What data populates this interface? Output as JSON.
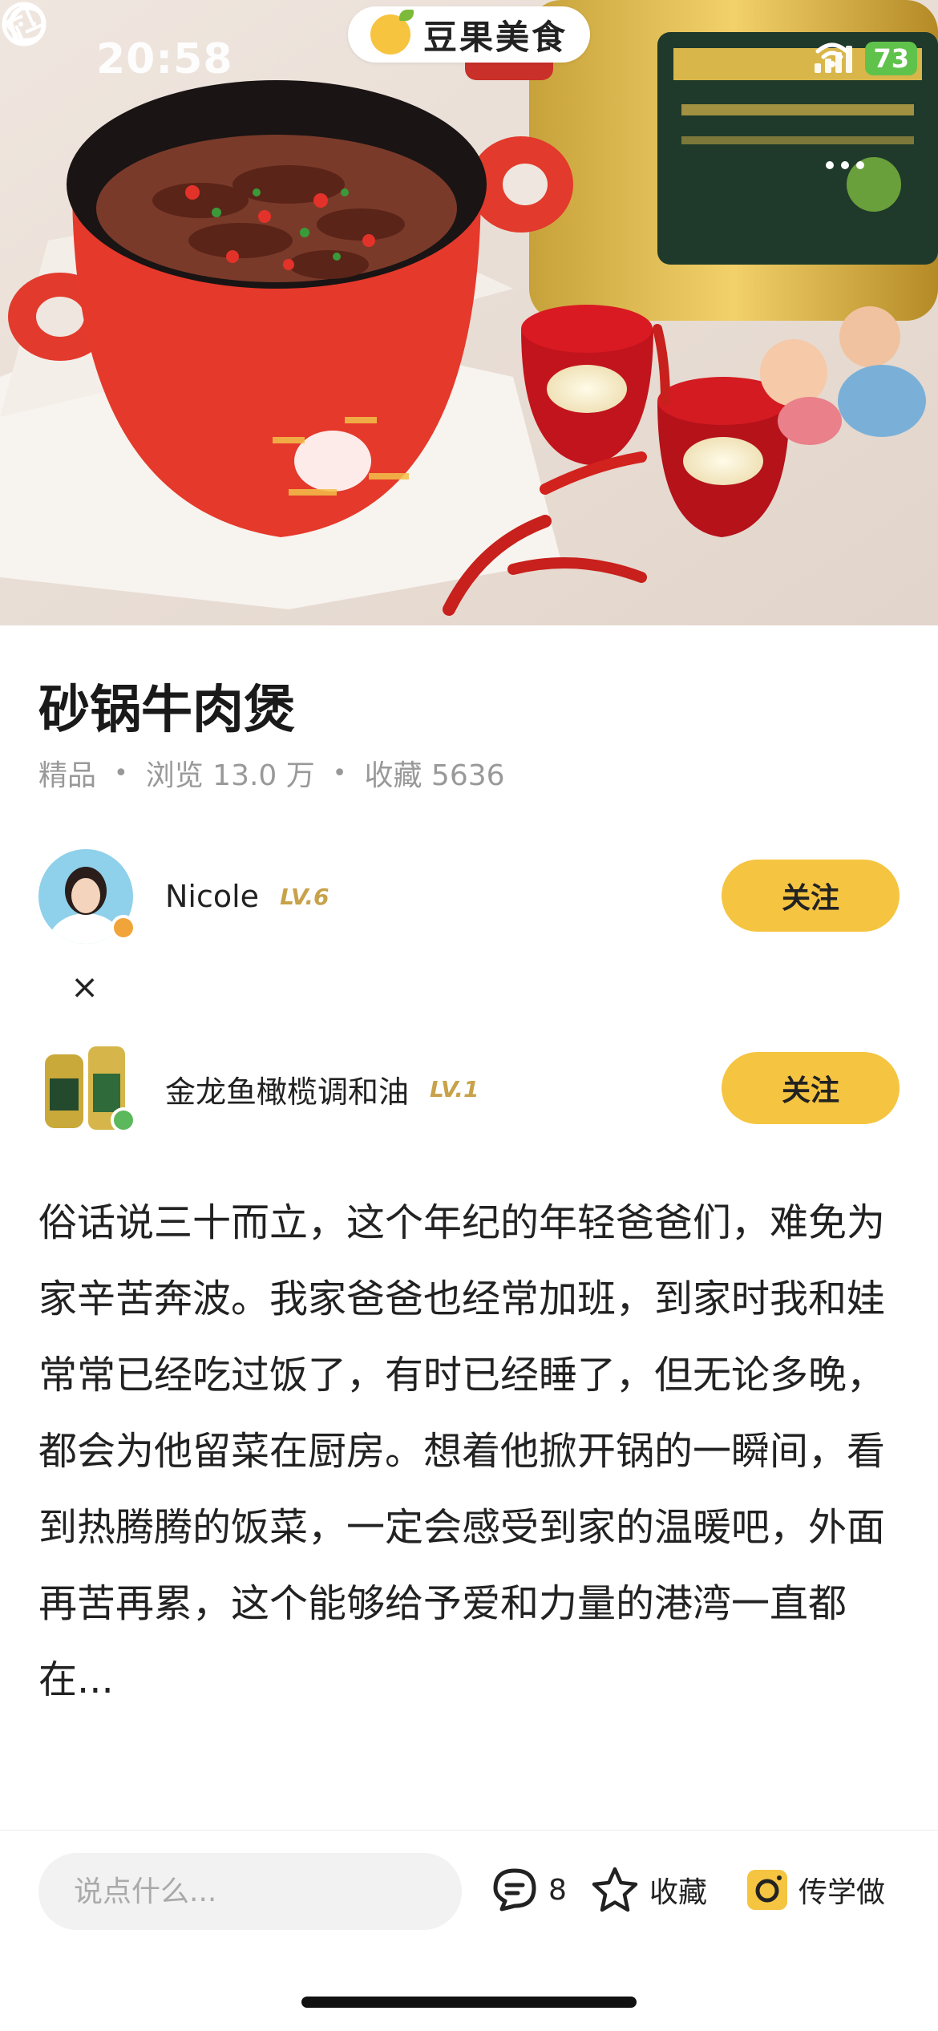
{
  "status_bar": {
    "time": "20:58",
    "battery": "73"
  },
  "brand": {
    "name": "豆果美食"
  },
  "recipe": {
    "title": "砂锅牛肉煲",
    "tag": "精品",
    "views": "浏览 13.0 万",
    "favorites": "收藏 5636",
    "description": "俗话说三十而立，这个年纪的年轻爸爸们，难免为家辛苦奔波。我家爸爸也经常加班，到家时我和娃常常已经吃过饭了，有时已经睡了，但无论多晚，都会为他留菜在厨房。想着他掀开锅的一瞬间，看到热腾腾的饭菜，一定会感受到家的温暖吧，外面再苦再累，这个能够给予爱和力量的港湾一直都在..."
  },
  "authors": [
    {
      "name": "Nicole",
      "level": "LV.6",
      "follow_label": "关注"
    },
    {
      "name": "金龙鱼橄榄调和油",
      "level": "LV.1",
      "follow_label": "关注"
    }
  ],
  "collab_separator": "×",
  "bottom_bar": {
    "comment_placeholder": "说点什么...",
    "comment_count": "8",
    "favorite_label": "收藏",
    "upload_label": "传学做"
  },
  "colors": {
    "accent": "#f5c440",
    "level": "#c8a24a"
  }
}
